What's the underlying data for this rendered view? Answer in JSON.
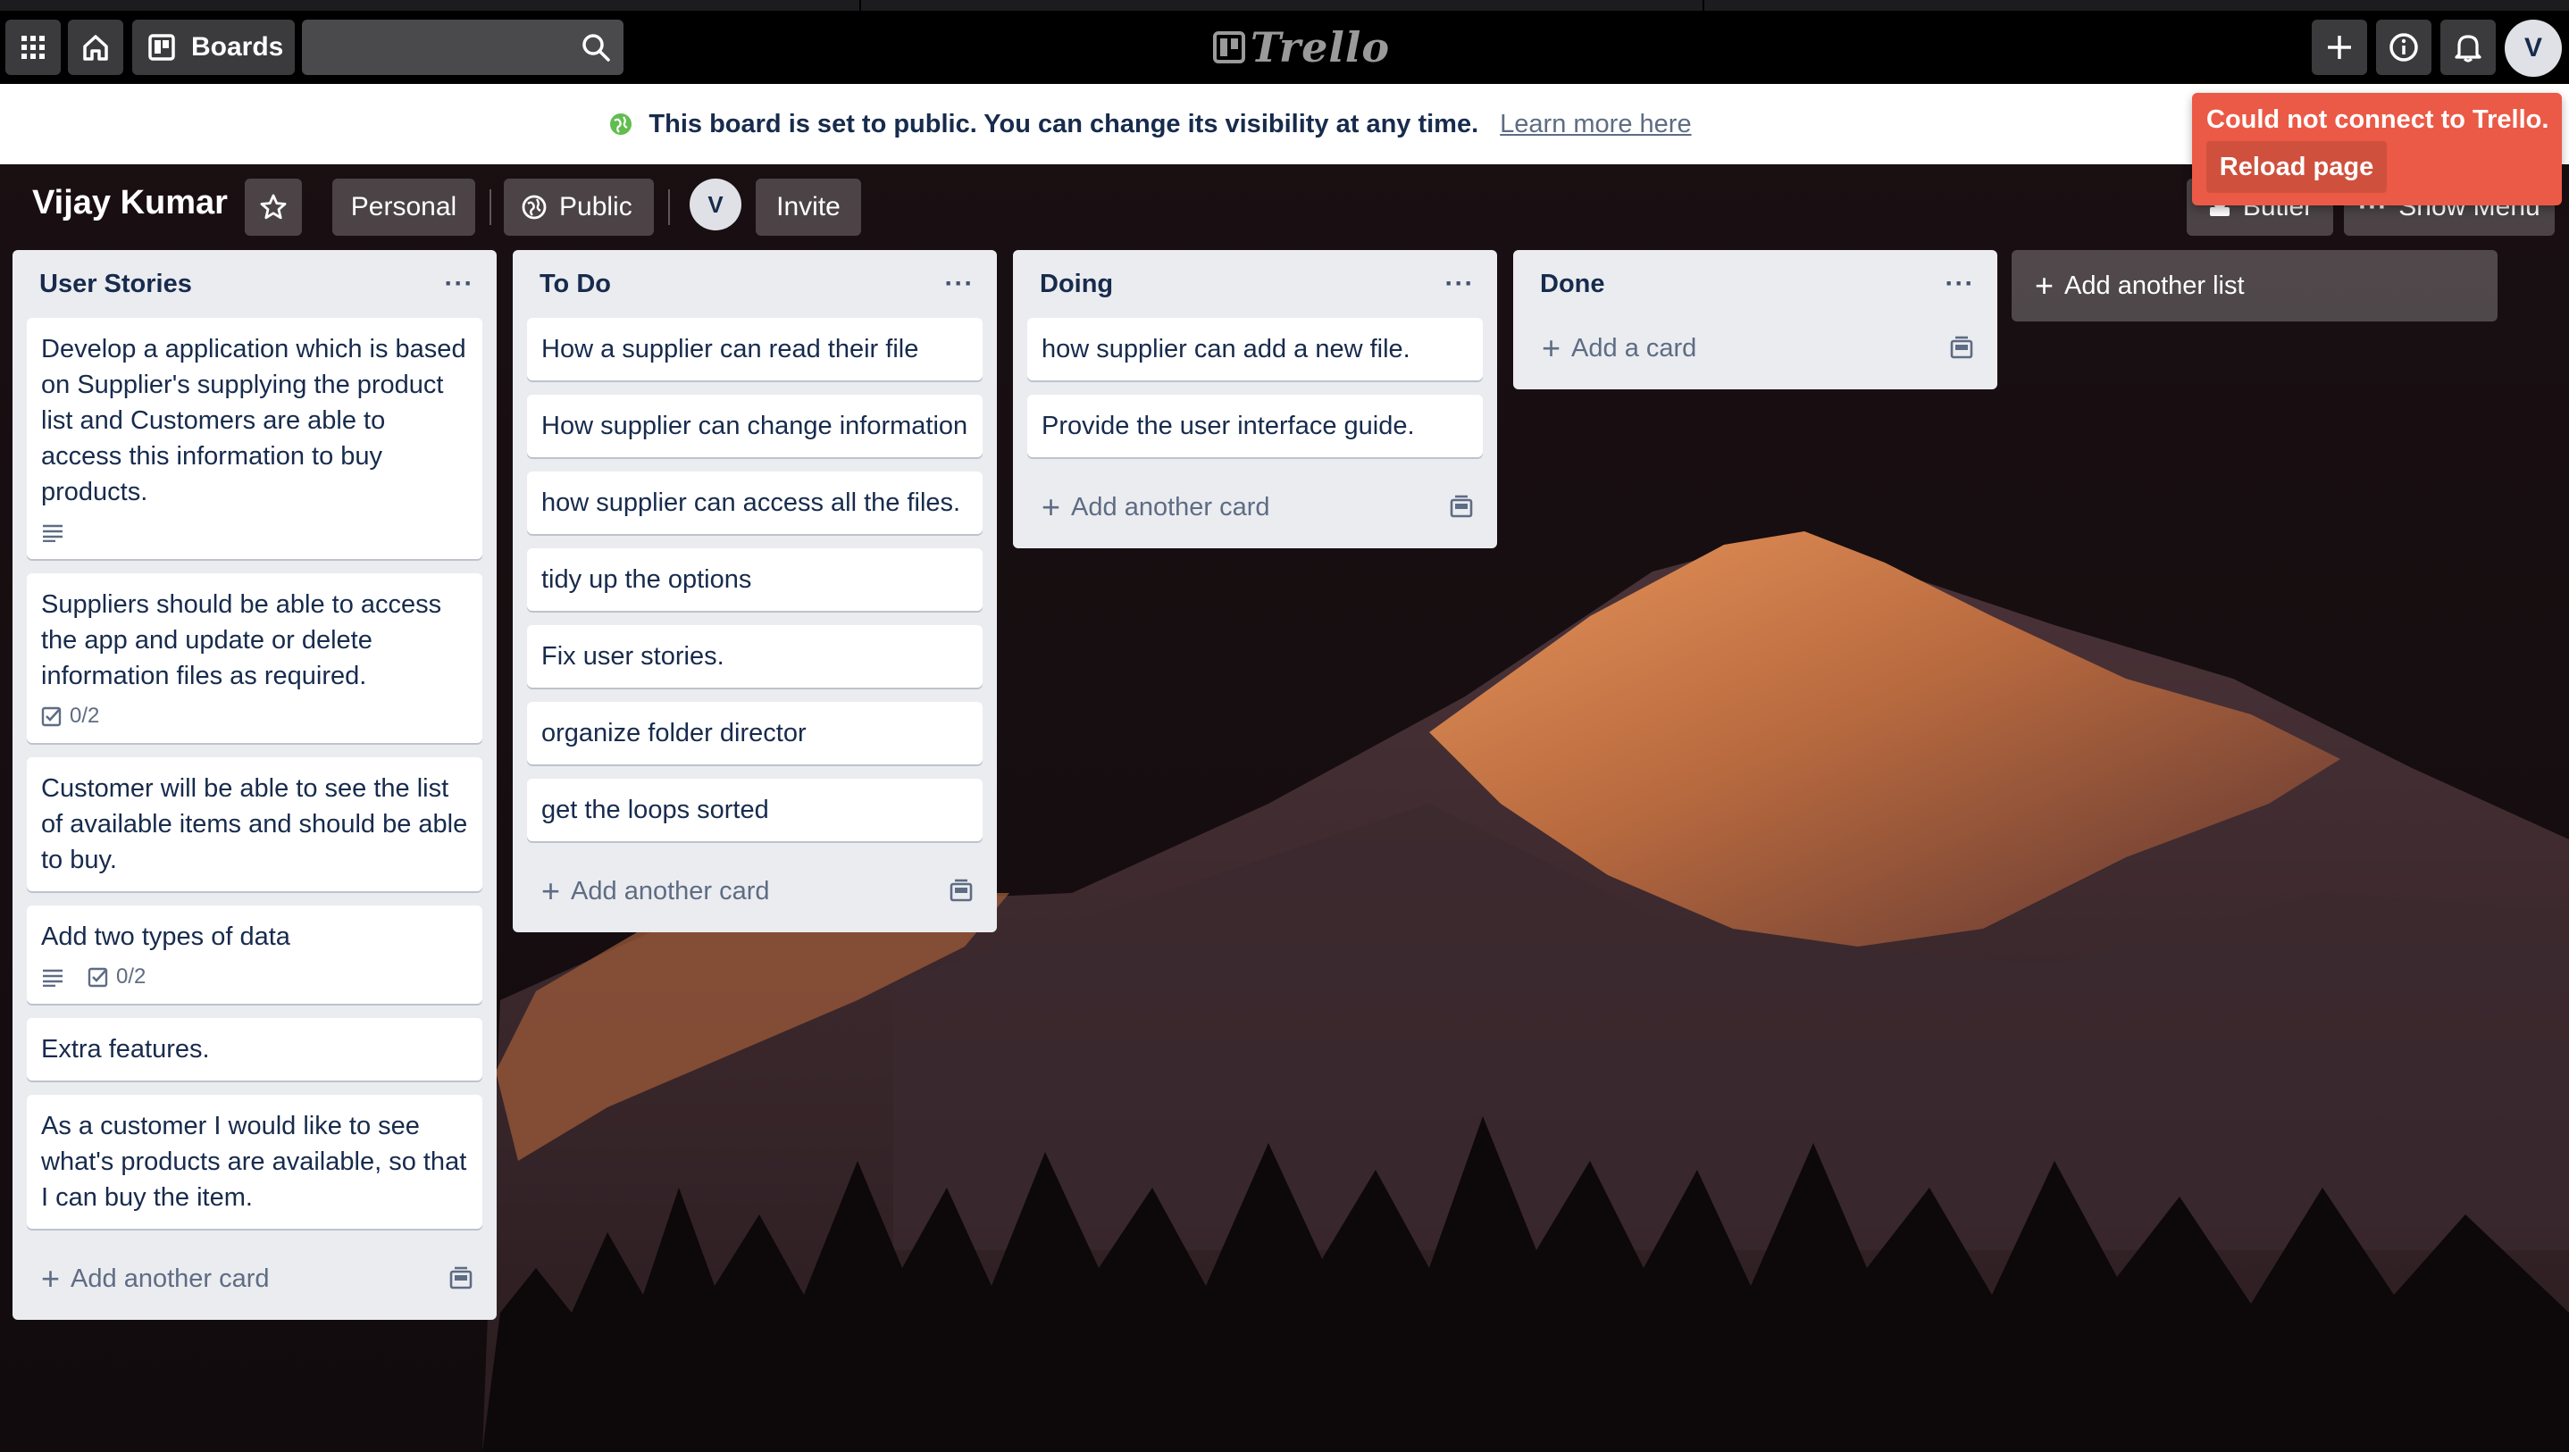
{
  "topbar": {
    "apps_icon": "grid-icon",
    "home_icon": "home-icon",
    "boards_label": "Boards",
    "search_placeholder": "",
    "logo_text": "Trello",
    "create_icon": "plus-icon",
    "info_icon": "info-icon",
    "notifications_icon": "bell-icon",
    "avatar_initial": "V"
  },
  "banner": {
    "message": "This board is set to public. You can change its visibility at any time.",
    "link": "Learn more here",
    "icon": "globe-icon",
    "icon_color": "#61bd4f"
  },
  "error": {
    "message": "Could not connect to Trello.",
    "button": "Reload page",
    "color": "#eb5a46"
  },
  "board": {
    "title": "Vijay Kumar",
    "star_icon": "star-icon",
    "team_label": "Personal",
    "visibility_label": "Public",
    "member_initial": "V",
    "invite_label": "Invite",
    "butler_label": "Butler",
    "menu_label": "Show Menu"
  },
  "lists": [
    {
      "title": "User Stories",
      "add_label": "Add another card",
      "cards": [
        {
          "text": "Develop a application which is based on Supplier's supplying the product list and Customers are able to access this information to buy products.",
          "description": true,
          "checklist": ""
        },
        {
          "text": "Suppliers should be able to access the app and update or delete information files as required.",
          "description": false,
          "checklist": "0/2"
        },
        {
          "text": "Customer will be able to see the list of available items and should be able to buy.",
          "description": false,
          "checklist": ""
        },
        {
          "text": "Add two types of data",
          "description": true,
          "checklist": "0/2"
        },
        {
          "text": "Extra features.",
          "description": false,
          "checklist": ""
        },
        {
          "text": "As a customer I would like to see what's products are available, so that I can buy the item.",
          "description": false,
          "checklist": ""
        }
      ]
    },
    {
      "title": "To Do",
      "add_label": "Add another card",
      "cards": [
        {
          "text": "How a supplier can read their file"
        },
        {
          "text": "How supplier can change information"
        },
        {
          "text": "how supplier can access all the files."
        },
        {
          "text": "tidy up the options"
        },
        {
          "text": "Fix user stories."
        },
        {
          "text": "organize folder director"
        },
        {
          "text": "get the loops sorted"
        }
      ]
    },
    {
      "title": "Doing",
      "add_label": "Add another card",
      "cards": [
        {
          "text": "how supplier can add a new file."
        },
        {
          "text": "Provide the user interface guide."
        }
      ]
    },
    {
      "title": "Done",
      "add_label": "Add a card",
      "cards": []
    }
  ],
  "add_list_label": "Add another list"
}
